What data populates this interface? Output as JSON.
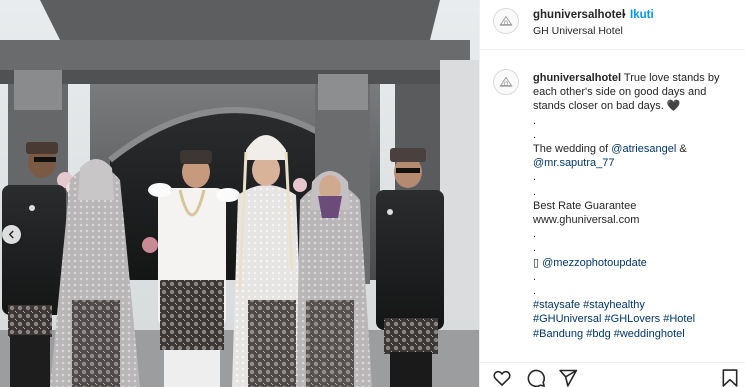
{
  "post": {
    "username": "ghuniversalhotel",
    "dot": "•",
    "follow_label": "Ikuti",
    "location": "GH Universal Hotel"
  },
  "caption": {
    "username": "ghuniversalhotel",
    "text_1": "True love stands by each other's side on good days and stands closer on bad days. ",
    "heart": "🖤",
    "dot": ".",
    "wedding_prefix": "The wedding of ",
    "mention_bride": "@atriesangel",
    "amp": " &",
    "mention_groom": "@mr.saputra_77",
    "rate": "Best Rate Guarantee",
    "website": "www.ghuniversal.com",
    "camera_glyph": "▯",
    "mention_photo": "@mezzophotoupdate",
    "hashtags_1": "#staysafe #stayhealthy",
    "hashtags_2": "#GHUniversal #GHLovers #Hotel",
    "hashtags_3": "#Bandung #bdg #weddinghotel"
  },
  "icons": {
    "avatar": "hotel-logo-icon",
    "prev": "chevron-left-icon",
    "like": "heart-icon",
    "comment": "comment-icon",
    "share": "paper-plane-icon",
    "save": "bookmark-icon"
  },
  "colors": {
    "follow": "#0095f6",
    "link": "#00376b",
    "border": "#efefef"
  }
}
